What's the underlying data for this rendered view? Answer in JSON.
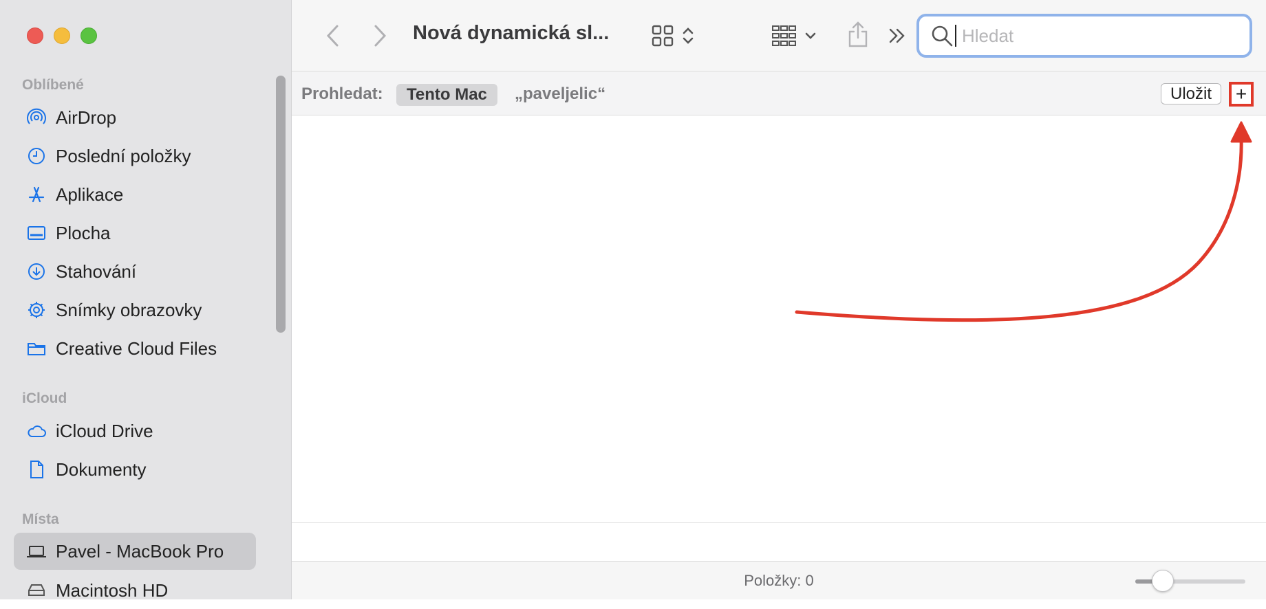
{
  "sidebar": {
    "sections": [
      {
        "label": "Oblíbené"
      },
      {
        "label": "iCloud"
      },
      {
        "label": "Místa"
      }
    ],
    "items": [
      {
        "label": "AirDrop",
        "icon": "airdrop-icon"
      },
      {
        "label": "Poslední položky",
        "icon": "clock-icon"
      },
      {
        "label": "Aplikace",
        "icon": "applications-icon"
      },
      {
        "label": "Plocha",
        "icon": "desktop-icon"
      },
      {
        "label": "Stahování",
        "icon": "download-icon"
      },
      {
        "label": "Snímky obrazovky",
        "icon": "gear-icon"
      },
      {
        "label": "Creative Cloud Files",
        "icon": "folder-icon"
      },
      {
        "label": "iCloud Drive",
        "icon": "cloud-icon"
      },
      {
        "label": "Dokumenty",
        "icon": "document-icon"
      },
      {
        "label": "Pavel - MacBook Pro",
        "icon": "laptop-icon",
        "selected": true
      },
      {
        "label": "Macintosh HD",
        "icon": "disk-icon"
      }
    ]
  },
  "toolbar": {
    "title": "Nová dynamická sl...",
    "search_placeholder": "Hledat"
  },
  "scope": {
    "label": "Prohledat:",
    "this_mac": "Tento Mac",
    "user": "„paveljelic“",
    "save_label": "Uložit",
    "add_label": "+"
  },
  "status": {
    "items_text": "Položky: 0",
    "icon_size_level": 0.25
  },
  "colors": {
    "accent": "#1a73e8",
    "annotation": "#e0392a",
    "search_focus": "#8fb3ea"
  }
}
